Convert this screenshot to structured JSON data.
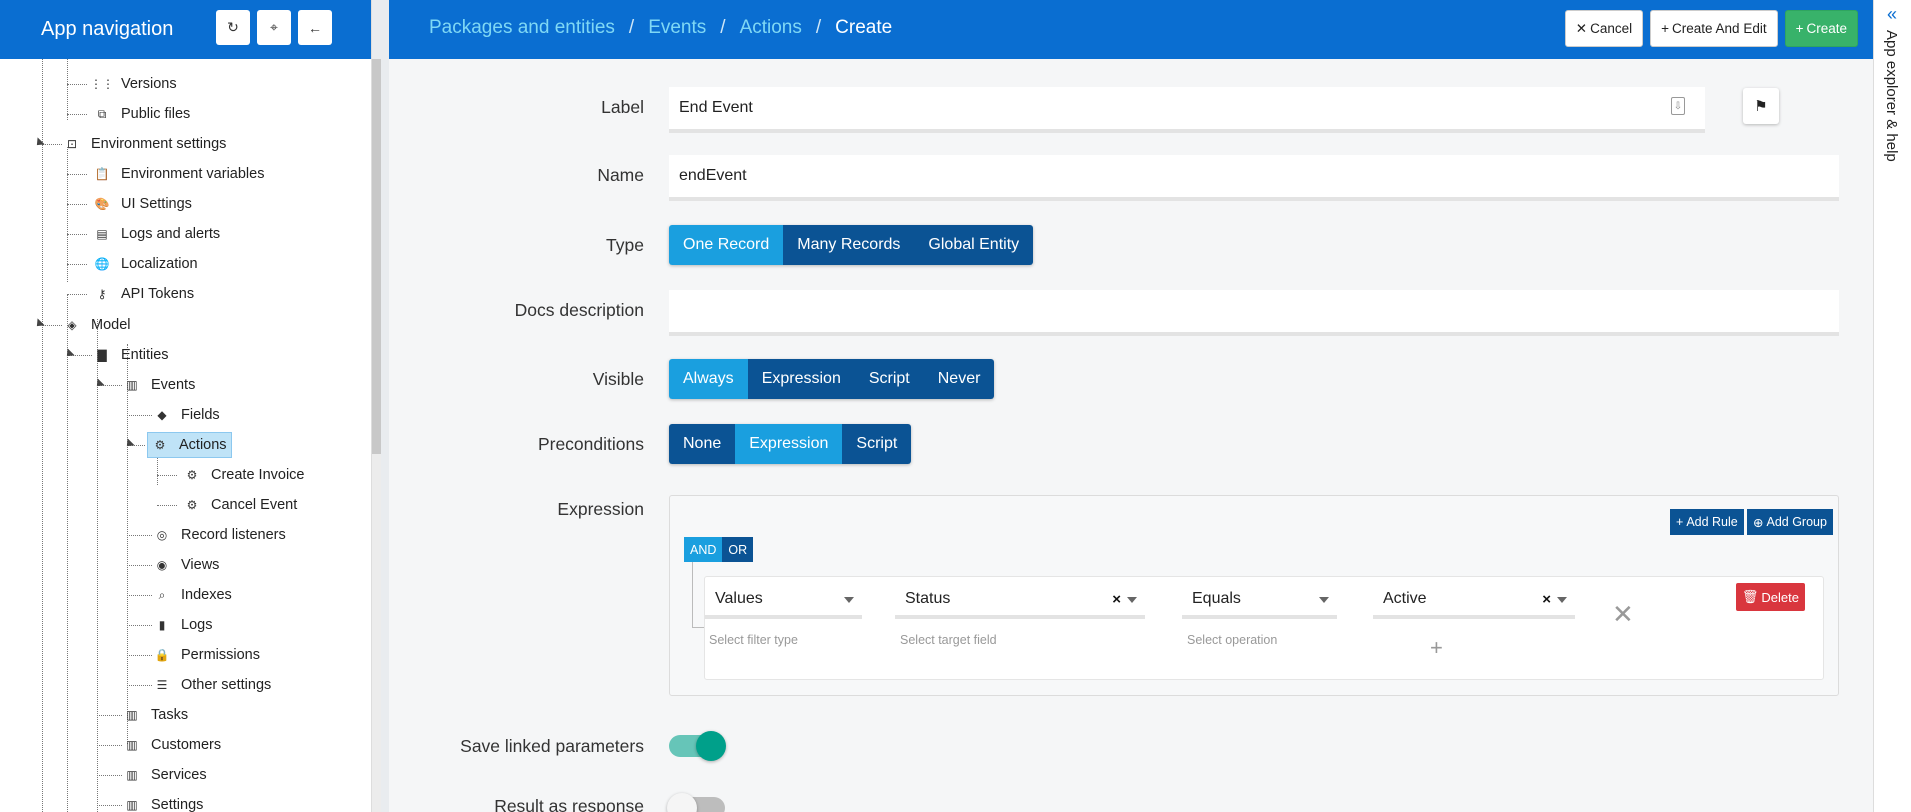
{
  "sidebar": {
    "title": "App navigation",
    "buttons": [
      {
        "icon": "refresh-icon",
        "glyph": "↻"
      },
      {
        "icon": "crosshair-icon",
        "glyph": "⌖"
      },
      {
        "icon": "arrow-left-icon",
        "glyph": "←"
      }
    ],
    "tree": [
      {
        "label": "Versions",
        "icon": "grid-icon",
        "glyph": "⋮⋮"
      },
      {
        "label": "Public files",
        "icon": "files-icon",
        "glyph": "⧉"
      },
      {
        "label": "Environment settings",
        "icon": "environment-icon",
        "glyph": "⊡"
      },
      {
        "label": "Environment variables",
        "icon": "clipboard-icon",
        "glyph": "📋"
      },
      {
        "label": "UI Settings",
        "icon": "palette-icon",
        "glyph": "🎨"
      },
      {
        "label": "Logs and alerts",
        "icon": "alert-message-icon",
        "glyph": "▤"
      },
      {
        "label": "Localization",
        "icon": "globe-icon",
        "glyph": "🌐"
      },
      {
        "label": "API Tokens",
        "icon": "key-icon",
        "glyph": "⚷"
      },
      {
        "label": "Model",
        "icon": "layers-icon",
        "glyph": "◈"
      },
      {
        "label": "Entities",
        "icon": "folder-icon",
        "glyph": "▇"
      },
      {
        "label": "Events",
        "icon": "entity-icon",
        "glyph": "▥"
      },
      {
        "label": "Fields",
        "icon": "tag-icon",
        "glyph": "◆"
      },
      {
        "label": "Actions",
        "icon": "gear-icon",
        "glyph": "⚙"
      },
      {
        "label": "Create Invoice",
        "icon": "gear-icon",
        "glyph": "⚙"
      },
      {
        "label": "Cancel Event",
        "icon": "gear-icon",
        "glyph": "⚙"
      },
      {
        "label": "Record listeners",
        "icon": "ear-icon",
        "glyph": "◎"
      },
      {
        "label": "Views",
        "icon": "eye-icon",
        "glyph": "◉"
      },
      {
        "label": "Indexes",
        "icon": "search-icon",
        "glyph": "⌕"
      },
      {
        "label": "Logs",
        "icon": "bookmark-icon",
        "glyph": "▮"
      },
      {
        "label": "Permissions",
        "icon": "lock-icon",
        "glyph": "🔒"
      },
      {
        "label": "Other settings",
        "icon": "list-icon",
        "glyph": "☰"
      },
      {
        "label": "Tasks",
        "icon": "entity-icon",
        "glyph": "▥"
      },
      {
        "label": "Customers",
        "icon": "entity-icon",
        "glyph": "▥"
      },
      {
        "label": "Services",
        "icon": "entity-icon",
        "glyph": "▥"
      },
      {
        "label": "Settings",
        "icon": "entity-icon",
        "glyph": "▥"
      }
    ]
  },
  "header": {
    "breadcrumb": [
      "Packages and entities",
      "Events",
      "Actions"
    ],
    "current": "Create",
    "cancel_label": "Cancel",
    "create_edit_label": "Create And Edit",
    "create_label": "Create"
  },
  "right_rail": {
    "label": "App explorer & help",
    "chevron": "«"
  },
  "form": {
    "label_label": "Label",
    "label_value": "End Event",
    "name_label": "Name",
    "name_value": "endEvent",
    "type_label": "Type",
    "type_options": [
      "One Record",
      "Many Records",
      "Global Entity"
    ],
    "type_selected": "One Record",
    "docs_label": "Docs description",
    "docs_value": "",
    "visible_label": "Visible",
    "visible_options": [
      "Always",
      "Expression",
      "Script",
      "Never"
    ],
    "visible_selected": "Always",
    "preconditions_label": "Preconditions",
    "preconditions_options": [
      "None",
      "Expression",
      "Script"
    ],
    "preconditions_selected": "Expression",
    "expression_label": "Expression",
    "save_linked_label": "Save linked parameters",
    "save_linked_on": true,
    "result_label": "Result as response",
    "result_on": false
  },
  "expression": {
    "add_rule_label": "Add Rule",
    "add_group_label": "Add Group",
    "and_label": "AND",
    "or_label": "OR",
    "selected_conjunction": "AND",
    "delete_label": "Delete",
    "rule": {
      "filter_type": "Values",
      "filter_type_hint": "Select filter type",
      "target_field": "Status",
      "target_field_hint": "Select target field",
      "operation": "Equals",
      "operation_hint": "Select operation",
      "value": "Active"
    }
  },
  "colors": {
    "brand": "#0a6ed1",
    "selected": "#1a9fdf",
    "dark_blue": "#0b5394",
    "create_green": "#38b26a",
    "delete_red": "#d9363e",
    "toggle_on": "#00a08a"
  }
}
